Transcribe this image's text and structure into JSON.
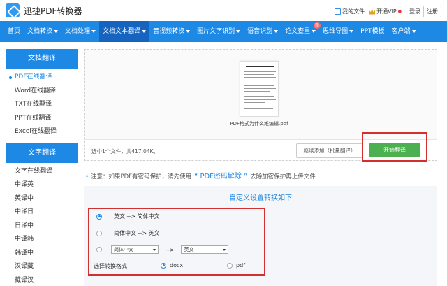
{
  "header": {
    "brand": "迅捷PDF转换器",
    "my_files": "我的文件",
    "vip": "开通VIP",
    "login": "登录",
    "register": "注册"
  },
  "nav": {
    "items": [
      {
        "label": "首页",
        "dropdown": false
      },
      {
        "label": "文档转换",
        "dropdown": true
      },
      {
        "label": "文档处理",
        "dropdown": true
      },
      {
        "label": "文档文本翻译",
        "dropdown": true
      },
      {
        "label": "音视频转换",
        "dropdown": true
      },
      {
        "label": "图片文字识别",
        "dropdown": true
      },
      {
        "label": "语音识别",
        "dropdown": true
      },
      {
        "label": "论文查重",
        "dropdown": true
      },
      {
        "label": "思维导图",
        "dropdown": true
      },
      {
        "label": "PPT模板",
        "dropdown": false
      },
      {
        "label": "客户端",
        "dropdown": true
      }
    ],
    "new_badge": "新"
  },
  "sidebar": {
    "doc_section": {
      "title": "文档翻译",
      "items": [
        "PDF在线翻译",
        "Word在线翻译",
        "TXT在线翻译",
        "PPT在线翻译",
        "Excel在线翻译"
      ]
    },
    "text_section": {
      "title": "文字翻译",
      "items": [
        "文字在线翻译",
        "中译英",
        "英译中",
        "中译日",
        "日译中",
        "中译韩",
        "韩译中",
        "汉译藏",
        "藏译汉"
      ]
    }
  },
  "upload": {
    "file_name": "PDF格式为什么难编辑.pdf",
    "file_info": "选中1个文件，共417.04K。",
    "add_button": "继续添加（批量翻译）",
    "start_button": "开始翻译"
  },
  "note": {
    "prefix": "注意：如果PDF有密码保护，请先使用",
    "link": "“ PDF密码解除 ”",
    "suffix": "去除加密保护再上传文件"
  },
  "settings": {
    "title": "自定义设置转换如下",
    "option1": "英文 --> 简体中文",
    "option2": "简体中文 --> 英文",
    "source_lang": "简体中文",
    "arrow": "-->",
    "target_lang": "英文",
    "format_label": "选择转换格式",
    "format_docx": "docx",
    "format_pdf": "pdf"
  },
  "colors": {
    "primary": "#1e88e5",
    "start_button": "#4caf50",
    "highlight_box": "#d32f2f"
  }
}
